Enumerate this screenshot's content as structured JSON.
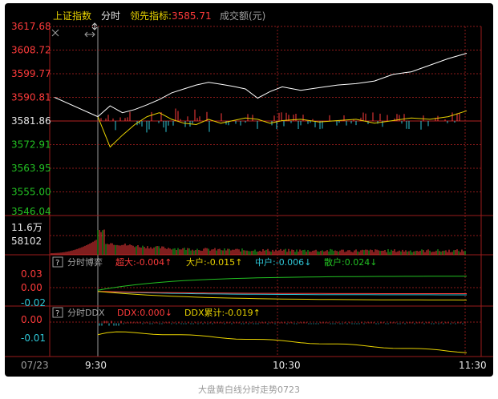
{
  "caption": "大盘黄白线分时走势0723",
  "header": {
    "index_name": "上证指数",
    "mode": "分时",
    "leading_label": "领先指标:",
    "leading_value": "3585.71",
    "volume_label": "成交额(元)"
  },
  "icons": {
    "close": "close-icon",
    "cursor": "crosshair-icon",
    "resize": "resize-arrows-icon"
  },
  "colors": {
    "background": "#000000",
    "grid": "#8b1a1a",
    "index_line": "#ffffff",
    "leading_line": "#e8d200",
    "up": "#ff3b3b",
    "down": "#2ec6d6",
    "chaoda": "#ff3b3b",
    "dahu": "#e8d200",
    "zhonghu": "#2ec6d6",
    "sanhu": "#22c022",
    "ddx": "#ff3b3b",
    "ddx_cum": "#e8d200"
  },
  "time_axis": [
    "07/23",
    "9:30",
    "10:30",
    "11:30"
  ],
  "price_panel": {
    "ticks": [
      "3617.68",
      "3608.72",
      "3599.77",
      "3590.81",
      "3581.86",
      "3572.91",
      "3563.95",
      "3555.00",
      "3546.04"
    ],
    "range": [
      3546.04,
      3617.68
    ],
    "prev_close": 3581.86
  },
  "volume_panel": {
    "ticks": [
      "11.6万",
      "58102"
    ]
  },
  "game_panel": {
    "help": "?",
    "title": "分时博弈",
    "items": [
      {
        "label": "超大:",
        "value": "-0.004",
        "arrow": "↑"
      },
      {
        "label": "大户:",
        "value": "-0.015",
        "arrow": "↑"
      },
      {
        "label": "中户:",
        "value": "-0.006",
        "arrow": "↓"
      },
      {
        "label": "散户:",
        "value": "0.024",
        "arrow": "↓"
      }
    ],
    "ticks": [
      "0.03",
      "0.00",
      "-0.02"
    ],
    "range": [
      -0.025,
      0.035
    ]
  },
  "ddx_panel": {
    "help": "?",
    "title": "分时DDX",
    "items": [
      {
        "label": "DDX:",
        "value": "0.000",
        "arrow": "↓"
      },
      {
        "label": "DDX累计:",
        "value": "-0.019",
        "arrow": "↑"
      }
    ],
    "ticks": [
      "0.00",
      "-0.01"
    ],
    "range": [
      -0.022,
      0.004
    ]
  },
  "chart_data": {
    "type": "line",
    "x": [
      0,
      4,
      8,
      12,
      16,
      20,
      24,
      28,
      32,
      36,
      40,
      44,
      48,
      52,
      56,
      60,
      66,
      72,
      78,
      84,
      90,
      96,
      102,
      108,
      114,
      120
    ],
    "series": [
      {
        "name": "上证指数",
        "values": [
          3583.5,
          3587.6,
          3585.0,
          3586.2,
          3588.0,
          3590.0,
          3592.5,
          3594.0,
          3595.5,
          3596.5,
          3595.8,
          3595.0,
          3594.0,
          3590.5,
          3593.0,
          3594.8,
          3593.5,
          3594.5,
          3595.5,
          3596.0,
          3597.0,
          3599.5,
          3600.5,
          3603.0,
          3605.5,
          3607.5
        ]
      },
      {
        "name": "领先指标",
        "values": [
          3583.5,
          3572.0,
          3576.5,
          3580.5,
          3583.5,
          3585.0,
          3582.5,
          3581.0,
          3580.5,
          3582.5,
          3581.0,
          3582.0,
          3583.0,
          3582.5,
          3581.0,
          3582.0,
          3582.5,
          3581.5,
          3582.0,
          3582.5,
          3581.0,
          3582.0,
          3583.0,
          3582.5,
          3583.5,
          3585.71
        ]
      }
    ],
    "xlabel": "",
    "ylabel": ""
  }
}
